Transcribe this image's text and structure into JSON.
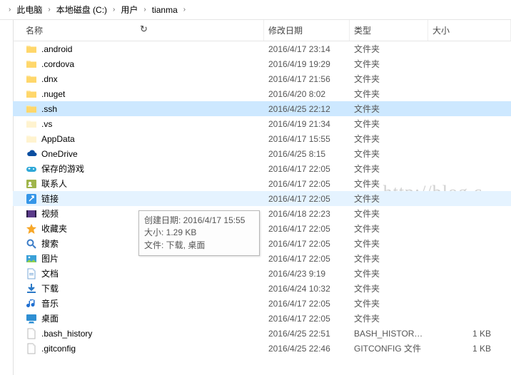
{
  "breadcrumb": {
    "items": [
      "此电脑",
      "本地磁盘 (C:)",
      "用户",
      "tianma"
    ]
  },
  "columns": {
    "name": "名称",
    "date": "修改日期",
    "type": "类型",
    "size": "大小"
  },
  "tooltip": {
    "line1_label": "创建日期: ",
    "line1_value": "2016/4/17 15:55",
    "line2_label": "大小: ",
    "line2_value": "1.29 KB",
    "line3_label": "文件: ",
    "line3_value": "下载, 桌面"
  },
  "watermark": "http://blog.c",
  "icons": {
    "folder": "folder-icon",
    "folder_hidden": "folder-hidden-icon",
    "onedrive": "onedrive-icon",
    "games": "games-icon",
    "contacts": "contacts-icon",
    "link": "link-icon",
    "video": "video-icon",
    "favorites": "favorites-icon",
    "search": "search-icon",
    "pictures": "pictures-icon",
    "documents": "documents-icon",
    "downloads": "downloads-icon",
    "music": "music-icon",
    "desktop": "desktop-icon",
    "file": "file-icon"
  },
  "rows": [
    {
      "name": ".android",
      "date": "2016/4/17 23:14",
      "type": "文件夹",
      "size": "",
      "icon": "folder",
      "state": ""
    },
    {
      "name": ".cordova",
      "date": "2016/4/19 19:29",
      "type": "文件夹",
      "size": "",
      "icon": "folder",
      "state": ""
    },
    {
      "name": ".dnx",
      "date": "2016/4/17 21:56",
      "type": "文件夹",
      "size": "",
      "icon": "folder",
      "state": ""
    },
    {
      "name": ".nuget",
      "date": "2016/4/20 8:02",
      "type": "文件夹",
      "size": "",
      "icon": "folder",
      "state": ""
    },
    {
      "name": ".ssh",
      "date": "2016/4/25 22:12",
      "type": "文件夹",
      "size": "",
      "icon": "folder",
      "state": "selected"
    },
    {
      "name": ".vs",
      "date": "2016/4/19 21:34",
      "type": "文件夹",
      "size": "",
      "icon": "folder_hidden",
      "state": ""
    },
    {
      "name": "AppData",
      "date": "2016/4/17 15:55",
      "type": "文件夹",
      "size": "",
      "icon": "folder_hidden",
      "state": ""
    },
    {
      "name": "OneDrive",
      "date": "2016/4/25 8:15",
      "type": "文件夹",
      "size": "",
      "icon": "onedrive",
      "state": ""
    },
    {
      "name": "保存的游戏",
      "date": "2016/4/17 22:05",
      "type": "文件夹",
      "size": "",
      "icon": "games",
      "state": ""
    },
    {
      "name": "联系人",
      "date": "2016/4/17 22:05",
      "type": "文件夹",
      "size": "",
      "icon": "contacts",
      "state": ""
    },
    {
      "name": "链接",
      "date": "2016/4/17 22:05",
      "type": "文件夹",
      "size": "",
      "icon": "link",
      "state": "hovered"
    },
    {
      "name": "视频",
      "date": "2016/4/18 22:23",
      "type": "文件夹",
      "size": "",
      "icon": "video",
      "state": ""
    },
    {
      "name": "收藏夹",
      "date": "2016/4/17 22:05",
      "type": "文件夹",
      "size": "",
      "icon": "favorites",
      "state": ""
    },
    {
      "name": "搜索",
      "date": "2016/4/17 22:05",
      "type": "文件夹",
      "size": "",
      "icon": "search",
      "state": ""
    },
    {
      "name": "图片",
      "date": "2016/4/17 22:05",
      "type": "文件夹",
      "size": "",
      "icon": "pictures",
      "state": ""
    },
    {
      "name": "文档",
      "date": "2016/4/23 9:19",
      "type": "文件夹",
      "size": "",
      "icon": "documents",
      "state": ""
    },
    {
      "name": "下载",
      "date": "2016/4/24 10:32",
      "type": "文件夹",
      "size": "",
      "icon": "downloads",
      "state": ""
    },
    {
      "name": "音乐",
      "date": "2016/4/17 22:05",
      "type": "文件夹",
      "size": "",
      "icon": "music",
      "state": ""
    },
    {
      "name": "桌面",
      "date": "2016/4/17 22:05",
      "type": "文件夹",
      "size": "",
      "icon": "desktop",
      "state": ""
    },
    {
      "name": ".bash_history",
      "date": "2016/4/25 22:51",
      "type": "BASH_HISTORY ...",
      "size": "1 KB",
      "icon": "file",
      "state": ""
    },
    {
      "name": ".gitconfig",
      "date": "2016/4/25 22:46",
      "type": "GITCONFIG 文件",
      "size": "1 KB",
      "icon": "file",
      "state": ""
    }
  ]
}
